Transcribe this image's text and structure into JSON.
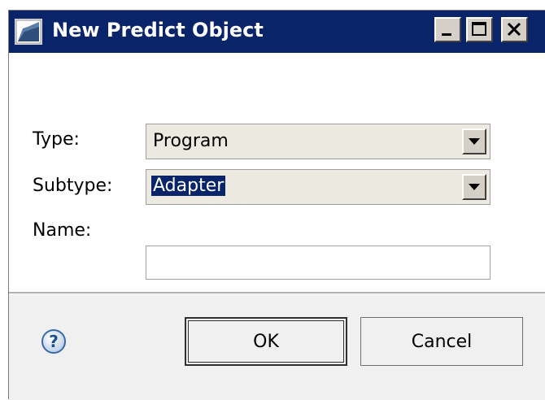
{
  "window": {
    "title": "New Predict Object",
    "controls": {
      "minimize": "minimize",
      "maximize": "maximize",
      "close": "close"
    }
  },
  "form": {
    "type": {
      "label": "Type:",
      "value": "Program"
    },
    "subtype": {
      "label": "Subtype:",
      "value": "Adapter"
    },
    "name": {
      "label": "Name:",
      "value": ""
    }
  },
  "footer": {
    "help_icon": "help-icon",
    "ok_label": "OK",
    "cancel_label": "Cancel"
  },
  "colors": {
    "titlebar": "#0a246a",
    "selection": "#0a246a",
    "footer": "#f0f0f0"
  }
}
